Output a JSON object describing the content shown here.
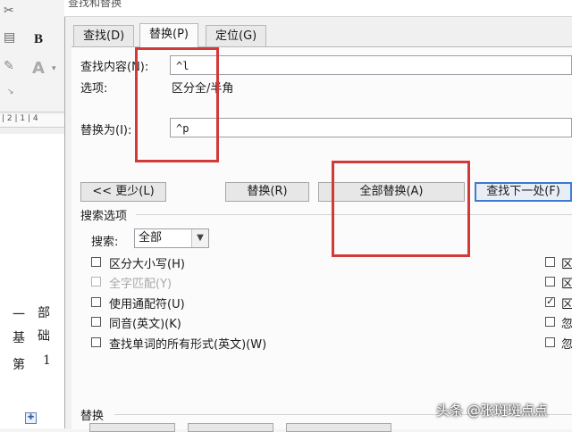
{
  "dialog": {
    "title": "查找和替换",
    "tabs": [
      {
        "label": "查找(D)"
      },
      {
        "label": "替换(P)"
      },
      {
        "label": "定位(G)"
      }
    ],
    "find": {
      "label": "查找内容(N):",
      "value": "^l"
    },
    "options": {
      "label": "选项:",
      "value": "区分全/半角"
    },
    "replace": {
      "label": "替换为(I):",
      "value": "^p"
    },
    "buttons": {
      "less": "<< 更少(L)",
      "replace": "替换(R)",
      "replace_all": "全部替换(A)",
      "find_next": "查找下一处(F)"
    },
    "search_options": {
      "title": "搜索选项",
      "search_label": "搜索:",
      "search_value": "全部",
      "checkboxes": [
        {
          "label": "区分大小写(H)",
          "checked": false,
          "disabled": false
        },
        {
          "label": "全字匹配(Y)",
          "checked": false,
          "disabled": true
        },
        {
          "label": "使用通配符(U)",
          "checked": false,
          "disabled": false
        },
        {
          "label": "同音(英文)(K)",
          "checked": false,
          "disabled": false
        },
        {
          "label": "查找单词的所有形式(英文)(W)",
          "checked": false,
          "disabled": false
        }
      ],
      "right_checkboxes": [
        {
          "label": "区",
          "checked": false
        },
        {
          "label": "区",
          "checked": false
        },
        {
          "label": "区",
          "checked": true
        },
        {
          "label": "忽",
          "checked": false
        },
        {
          "label": "忽",
          "checked": false
        }
      ]
    },
    "replace_section": {
      "title": "替换"
    }
  },
  "left_app": {
    "ribbon_bold": "B",
    "ribbon_font_a": "A",
    "ruler_text": "| 2 | 1 | 4",
    "doc_chars": [
      "一",
      "部",
      "基",
      "础",
      "第",
      "1"
    ]
  },
  "watermark": "头条 @张斑斑点点",
  "accent_colors": {
    "highlight_box": "#d23a3a",
    "default_button": "#3b7bd1"
  }
}
